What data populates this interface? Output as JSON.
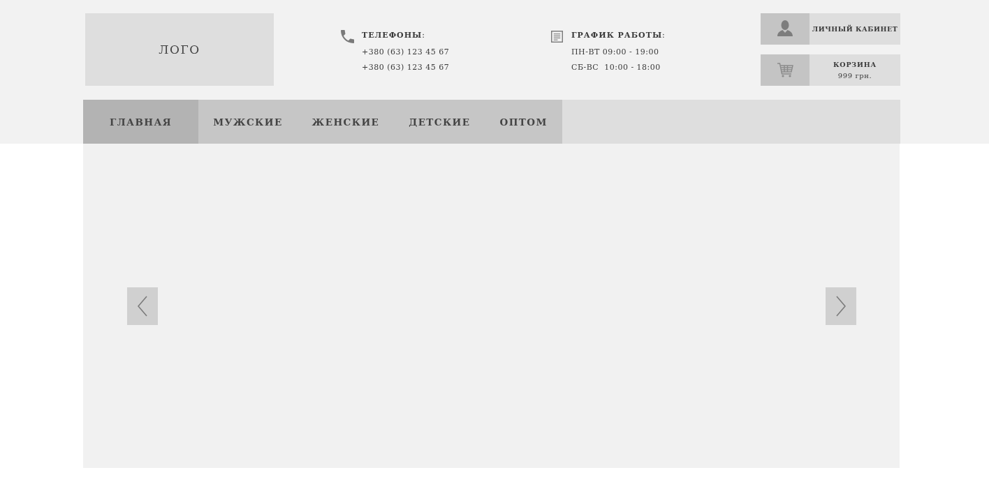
{
  "logo": {
    "text": "ЛОГО"
  },
  "phones": {
    "title": "**ТЕЛЕФОНЫ**:",
    "lines": [
      "+380 (63) 123 45 67",
      "+380 (63) 123 45 67"
    ]
  },
  "schedule": {
    "title": "**ГРАФИК РАБОТЫ**:",
    "lines": [
      "ПН-ВТ 09:00 - 19:00",
      "СБ-ВС  10:00 - 18:00"
    ]
  },
  "account": {
    "label": "ЛИЧНЫЙ КАБИНЕТ"
  },
  "cart": {
    "label": "КОРЗИНА",
    "total": "999 грн."
  },
  "nav": [
    {
      "label": "ГЛАВНАЯ",
      "selected": true
    },
    {
      "label": "МУЖСКИЕ",
      "selected": false
    },
    {
      "label": "ЖЕНСКИЕ",
      "selected": false
    },
    {
      "label": "ДЕТСКИЕ",
      "selected": false
    },
    {
      "label": "ОПТОМ",
      "selected": false
    }
  ]
}
